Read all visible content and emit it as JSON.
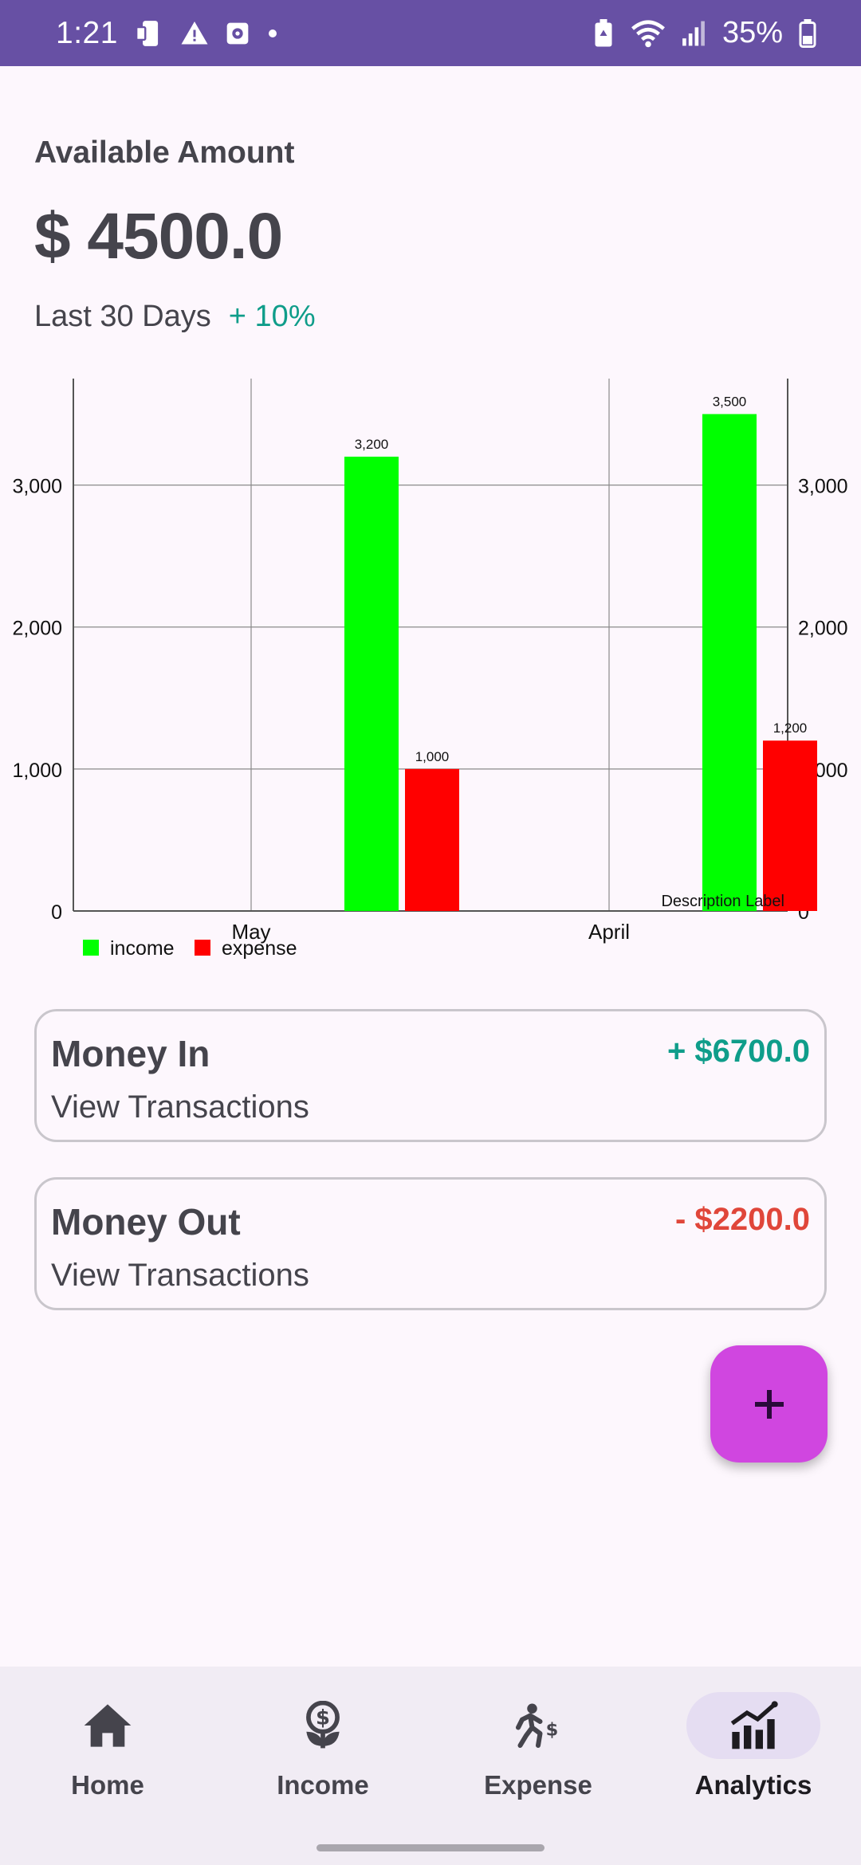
{
  "status_bar": {
    "time": "1:21",
    "battery_percent": "35%",
    "icons_left": [
      "device-storage-icon",
      "warning-icon",
      "app-notification-icon",
      "dot-icon"
    ],
    "icons_right": [
      "battery-saver-icon",
      "wifi-icon",
      "signal-icon",
      "battery-icon"
    ],
    "background": "#6750a4"
  },
  "header": {
    "title": "Available Amount",
    "amount": "$ 4500.0",
    "period_label": "Last 30 Days",
    "change": "+ 10%",
    "change_color": "#0f9d8a"
  },
  "chart_data": {
    "type": "bar",
    "categories": [
      "May",
      "April"
    ],
    "series": [
      {
        "name": "income",
        "color": "#00ff00",
        "values": [
          3200,
          3500
        ],
        "value_labels": [
          "3,200",
          "3,500"
        ]
      },
      {
        "name": "expense",
        "color": "#ff0000",
        "values": [
          1000,
          1200
        ],
        "value_labels": [
          "1,000",
          "1,200"
        ]
      }
    ],
    "ylim": [
      0,
      3750
    ],
    "yticks": [
      0,
      1000,
      2000,
      3000
    ],
    "ytick_labels": [
      "0",
      "1,000",
      "2,000",
      "3,000"
    ],
    "y_axis_right": true,
    "grid": true,
    "legend": "bottom-left",
    "description": "Description Label"
  },
  "cards": [
    {
      "title": "Money In",
      "amount": "+ $6700.0",
      "link": "View Transactions",
      "amount_color": "#0f9d8a"
    },
    {
      "title": "Money Out",
      "amount": "- $2200.0",
      "link": "View Transactions",
      "amount_color": "#e0463a"
    }
  ],
  "fab": {
    "icon": "plus-icon",
    "color": "#d046e0"
  },
  "bottom_nav": {
    "items": [
      {
        "label": "Home",
        "icon": "home-icon",
        "active": false
      },
      {
        "label": "Income",
        "icon": "income-icon",
        "active": false
      },
      {
        "label": "Expense",
        "icon": "expense-icon",
        "active": false
      },
      {
        "label": "Analytics",
        "icon": "analytics-icon",
        "active": true
      }
    ]
  }
}
